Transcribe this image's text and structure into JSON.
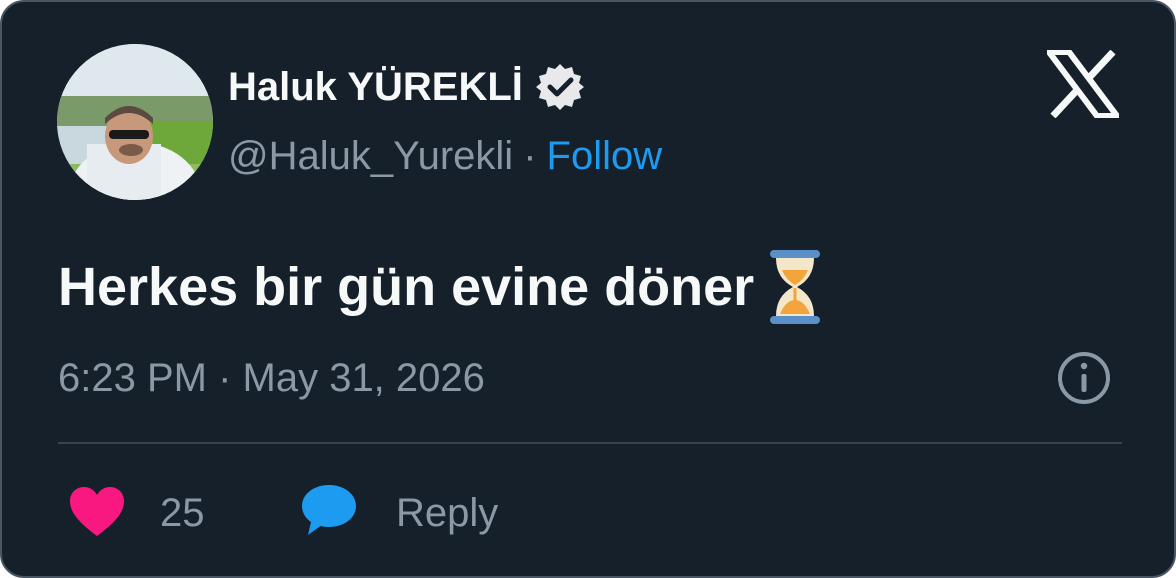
{
  "author": {
    "display_name": "Haluk YÜREKLİ",
    "handle": "@Haluk_Yurekli",
    "separator": "·",
    "follow_label": "Follow",
    "verified": true
  },
  "tweet": {
    "text": "Herkes bir gün evine döner",
    "emoji": "hourglass-emoji",
    "timestamp": "6:23 PM · May 31, 2026"
  },
  "actions": {
    "like_count": "25",
    "reply_label": "Reply"
  },
  "icons": {
    "brand": "x-logo-icon",
    "info": "info-icon",
    "like": "heart-icon",
    "reply": "speech-bubble-icon",
    "verified": "verified-badge-icon"
  },
  "colors": {
    "background": "#15202b",
    "text_primary": "#f7f9f9",
    "text_secondary": "#8b98a5",
    "accent": "#1d9bf0",
    "like": "#f91880"
  }
}
